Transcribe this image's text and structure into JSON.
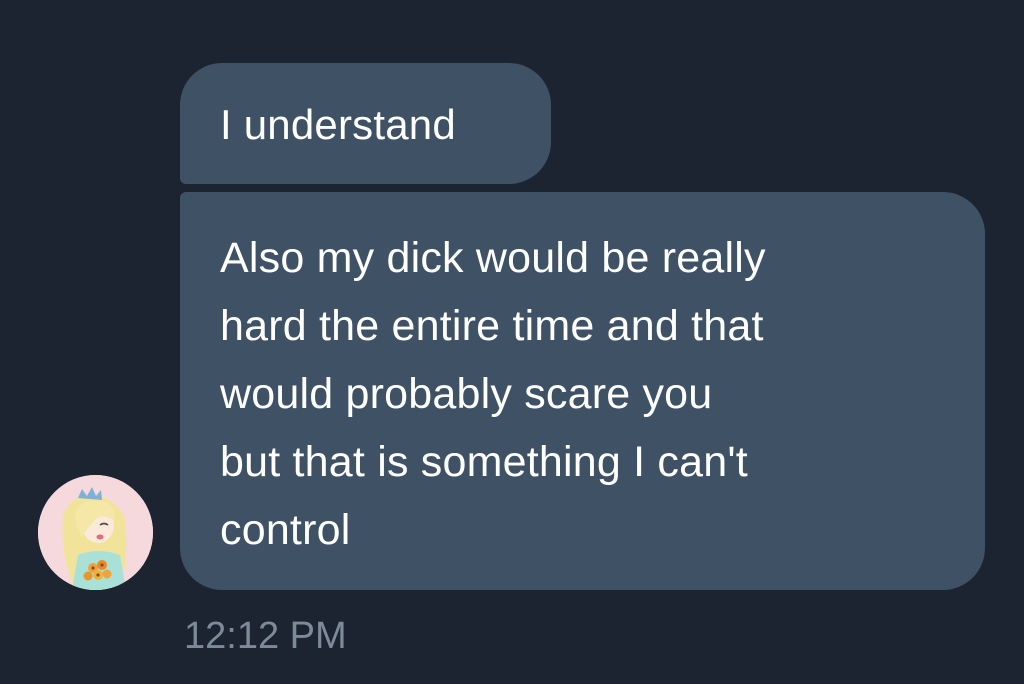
{
  "conversation": {
    "messages": [
      {
        "text": "I understand"
      },
      {
        "text": "Also my dick would be really\nhard the entire time and that\nwould probably scare you\nbut that is something I can't\ncontrol"
      }
    ],
    "timestamp": "12:12 PM",
    "sender": {
      "avatar_icon": "user-avatar-icon"
    }
  },
  "colors": {
    "background": "#1b2430",
    "bubble": "#3e5165",
    "text": "#ffffff",
    "timestamp": "#7d8b99"
  }
}
